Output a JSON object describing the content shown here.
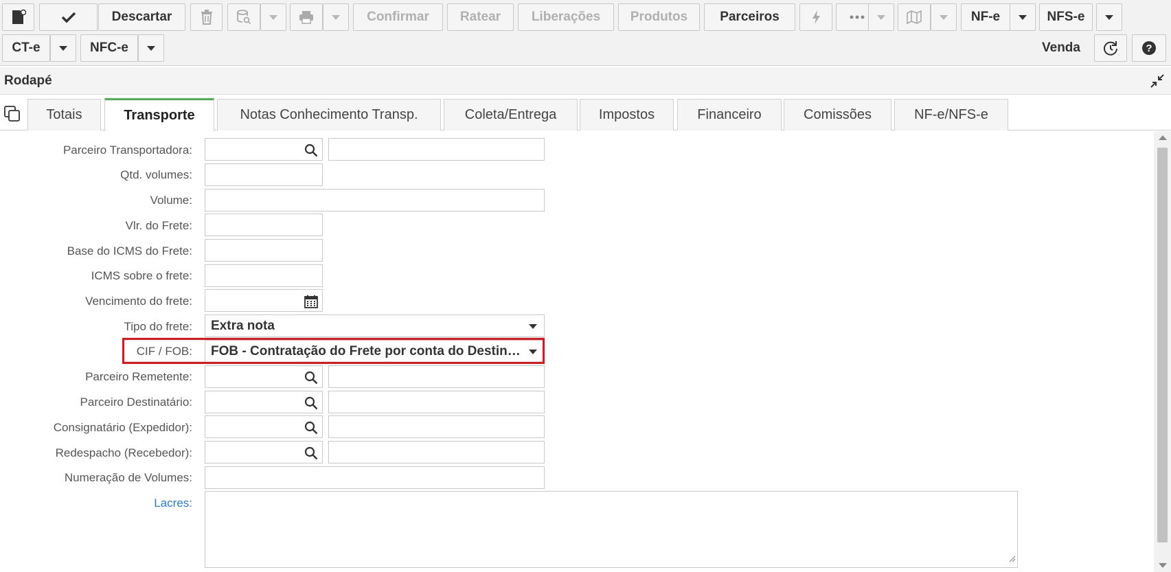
{
  "toolbar": {
    "descartar": "Descartar",
    "confirmar": "Confirmar",
    "ratear": "Ratear",
    "liberacoes": "Liberações",
    "produtos": "Produtos",
    "parceiros": "Parceiros",
    "nfe": "NF-e",
    "nfse": "NFS-e",
    "cte": "CT-e",
    "nfce": "NFC-e",
    "venda": "Venda"
  },
  "section": {
    "title": "Rodapé"
  },
  "tabs": [
    {
      "label": "Totais"
    },
    {
      "label": "Transporte"
    },
    {
      "label": "Notas Conhecimento Transp."
    },
    {
      "label": "Coleta/Entrega"
    },
    {
      "label": "Impostos"
    },
    {
      "label": "Financeiro"
    },
    {
      "label": "Comissões"
    },
    {
      "label": "NF-e/NFS-e"
    }
  ],
  "form": {
    "parceiro_transportadora": "Parceiro Transportadora:",
    "qtd_volumes": "Qtd. volumes:",
    "volume": "Volume:",
    "vlr_frete": "Vlr. do Frete:",
    "base_icms_frete": "Base do ICMS do Frete:",
    "icms_sobre_frete": "ICMS sobre o frete:",
    "vencimento_frete": "Vencimento do frete:",
    "tipo_frete": "Tipo do frete:",
    "tipo_frete_value": "Extra nota",
    "cif_fob": "CIF / FOB:",
    "cif_fob_value": "FOB - Contratação do Frete por conta do Destinatário",
    "parceiro_remetente": "Parceiro Remetente:",
    "parceiro_destinatario": "Parceiro Destinatário:",
    "consignatario": "Consignatário (Expedidor):",
    "redespacho": "Redespacho (Recebedor):",
    "numeracao_volumes": "Numeração de Volumes:",
    "lacres": "Lacres:"
  },
  "colors": {
    "active_tab_accent": "#4cb050",
    "highlight": "#e8121b",
    "link": "#2a7ad5"
  }
}
